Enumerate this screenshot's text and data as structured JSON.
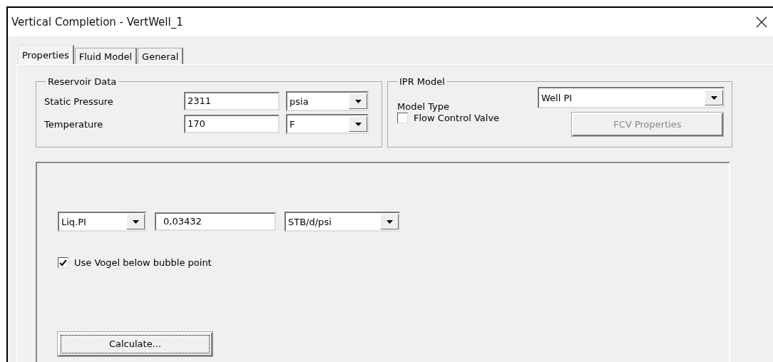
{
  "window": {
    "title": "Vertical Completion - VertWell_1"
  },
  "tabs": [
    {
      "label": "Properties",
      "selected": true
    },
    {
      "label": "Fluid Model",
      "selected": false
    },
    {
      "label": "General",
      "selected": false
    }
  ],
  "reservoir_data": {
    "title": "Reservoir Data",
    "rows": [
      {
        "label": "Static Pressure",
        "value": "2311",
        "unit": "psia"
      },
      {
        "label": "Temperature",
        "value": "170",
        "unit": "F"
      }
    ]
  },
  "ipr_model": {
    "title": "IPR Model",
    "model_type_label": "Model Type",
    "model_type": "Well PI",
    "flow_control_valve": {
      "label": "Flow Control Valve",
      "checked": false
    },
    "fcv_button": {
      "label": "FCV Properties",
      "disabled": true
    }
  },
  "pi": {
    "type": "Liq.PI",
    "value": "0,03432",
    "unit": "STB/d/psi"
  },
  "vogel": {
    "label": "Use Vogel below bubble point",
    "checked": true
  },
  "calculate_button": {
    "label": "Calculate...",
    "focused": true
  }
}
